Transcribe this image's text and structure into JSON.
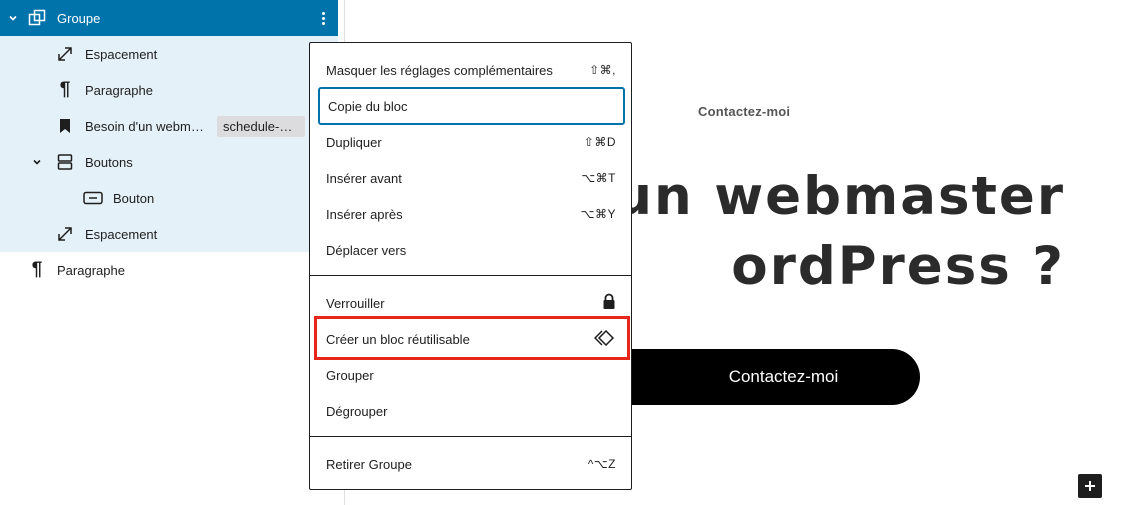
{
  "list_view": {
    "items": [
      {
        "label": "Groupe",
        "icon": "group-icon",
        "state": "active"
      },
      {
        "label": "Espacement",
        "icon": "spacer-resize-icon"
      },
      {
        "label": "Paragraphe",
        "icon": "paragraph-icon"
      },
      {
        "label": "Besoin d'un webm…",
        "icon": "bookmark-icon",
        "anchor": "schedule-…"
      },
      {
        "label": "Boutons",
        "icon": "buttons-icon"
      },
      {
        "label": "Bouton",
        "icon": "button-icon"
      },
      {
        "label": "Espacement",
        "icon": "spacer-resize-icon"
      },
      {
        "label": "Paragraphe",
        "icon": "paragraph-icon"
      }
    ]
  },
  "canvas": {
    "kicker": "Contactez-moi",
    "heading_line1": "d'un webmaster",
    "heading_line2": "ordPress ?",
    "button_label": "Contactez-moi"
  },
  "menu": {
    "group1": [
      {
        "label": "Masquer les réglages complémentaires",
        "shortcut": "⇧⌘,"
      },
      {
        "label": "Copie du bloc",
        "shortcut": "",
        "focused": true
      },
      {
        "label": "Dupliquer",
        "shortcut": "⇧⌘D"
      },
      {
        "label": "Insérer avant",
        "shortcut": "⌥⌘T"
      },
      {
        "label": "Insérer après",
        "shortcut": "⌥⌘Y"
      },
      {
        "label": "Déplacer vers",
        "shortcut": ""
      }
    ],
    "group2": [
      {
        "label": "Verrouiller",
        "icon": "lock-icon"
      },
      {
        "label": "Créer un bloc réutilisable",
        "icon": "reusable-block-icon",
        "highlighted": true
      },
      {
        "label": "Grouper"
      },
      {
        "label": "Dégrouper"
      }
    ],
    "group3": [
      {
        "label": "Retirer Groupe",
        "shortcut": "^⌥Z"
      }
    ]
  },
  "colors": {
    "accent": "#0073aa",
    "selection": "#e5f1f8",
    "highlight_frame": "#e8271b"
  }
}
